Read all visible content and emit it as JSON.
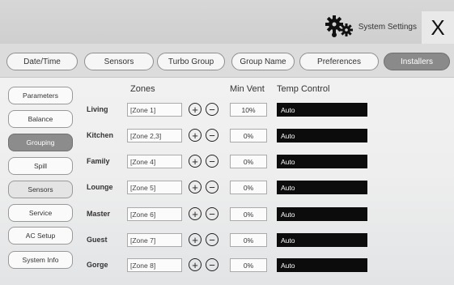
{
  "header": {
    "title": "System Settings",
    "close_label": "X"
  },
  "tabs": [
    {
      "label": "Date/Time"
    },
    {
      "label": "Sensors"
    },
    {
      "label": "Turbo Group"
    },
    {
      "label": "Group Name"
    },
    {
      "label": "Preferences"
    },
    {
      "label": "Installers",
      "active": true
    }
  ],
  "sidebar": [
    {
      "label": "Parameters"
    },
    {
      "label": "Balance"
    },
    {
      "label": "Grouping",
      "active": true
    },
    {
      "label": "Spill"
    },
    {
      "label": "Sensors"
    },
    {
      "label": "Service"
    },
    {
      "label": "AC Setup"
    },
    {
      "label": "System Info"
    }
  ],
  "columns": {
    "zones": "Zones",
    "min_vent": "Min Vent",
    "temp_control": "Temp Control"
  },
  "plus_symbol": "+",
  "minus_symbol": "−",
  "rows": [
    {
      "room": "Living",
      "zone": "[Zone 1]",
      "min_vent": "10%",
      "temp": "Auto"
    },
    {
      "room": "Kitchen",
      "zone": "[Zone 2,3]",
      "min_vent": "0%",
      "temp": "Auto"
    },
    {
      "room": "Family",
      "zone": "[Zone 4]",
      "min_vent": "0%",
      "temp": "Auto"
    },
    {
      "room": "Lounge",
      "zone": "[Zone 5]",
      "min_vent": "0%",
      "temp": "Auto"
    },
    {
      "room": "Master",
      "zone": "[Zone 6]",
      "min_vent": "0%",
      "temp": "Auto"
    },
    {
      "room": "Guest",
      "zone": "[Zone 7]",
      "min_vent": "0%",
      "temp": "Auto"
    },
    {
      "room": "Gorge",
      "zone": "[Zone 8]",
      "min_vent": "0%",
      "temp": "Auto"
    }
  ]
}
